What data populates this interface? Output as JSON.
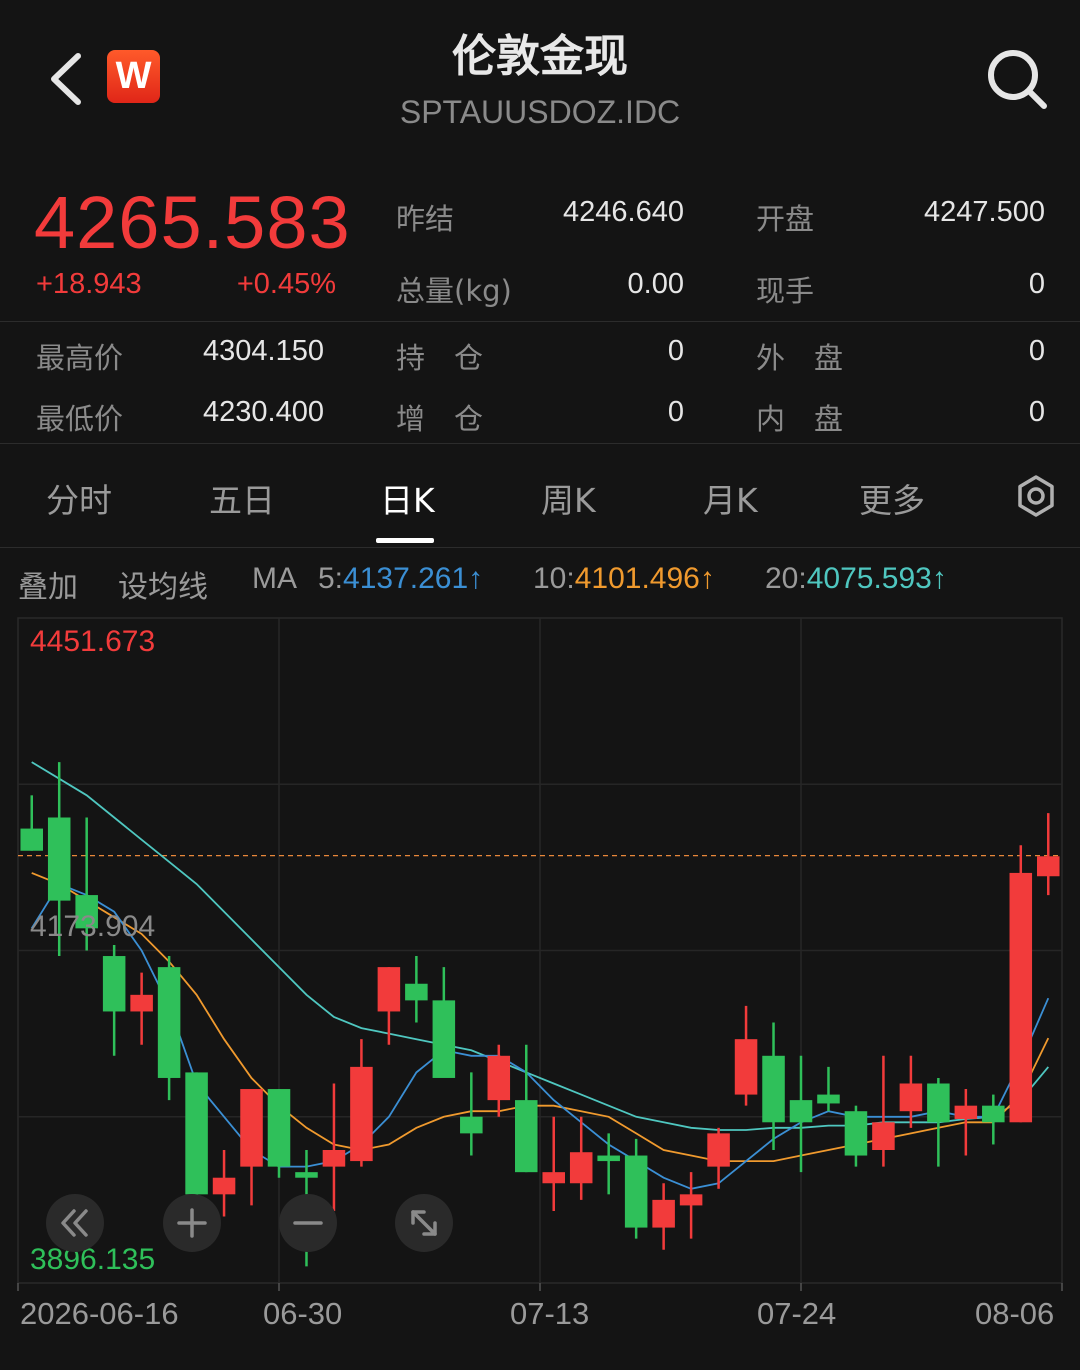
{
  "header": {
    "title": "伦敦金现",
    "code": "SPTAUUSDOZ.IDC",
    "logo_text": "W"
  },
  "quote": {
    "price": "4265.583",
    "change": "+18.943",
    "change_pct": "+0.45%",
    "fields": [
      {
        "label": "昨结",
        "value": "4246.640"
      },
      {
        "label": "开盘",
        "value": "4247.500"
      },
      {
        "label": "总量(kg)",
        "value": "0.00"
      },
      {
        "label": "现手",
        "value": "0"
      },
      {
        "label": "最高价",
        "value": "4304.150"
      },
      {
        "label": "持　仓",
        "value": "0"
      },
      {
        "label": "外　盘",
        "value": "0"
      },
      {
        "label": "最低价",
        "value": "4230.400"
      },
      {
        "label": "增　仓",
        "value": "0"
      },
      {
        "label": "内　盘",
        "value": "0"
      }
    ]
  },
  "tabs": [
    {
      "label": "分时",
      "active": false
    },
    {
      "label": "五日",
      "active": false
    },
    {
      "label": "日K",
      "active": true
    },
    {
      "label": "周K",
      "active": false
    },
    {
      "label": "月K",
      "active": false
    },
    {
      "label": "更多",
      "active": false
    }
  ],
  "ma_bar": {
    "overlay": "叠加",
    "set_ma": "设均线",
    "ma": "MA",
    "ma5_label": "5:",
    "ma5_value": "4137.261↑",
    "ma10_label": "10:",
    "ma10_value": "4101.496↑",
    "ma20_label": "20:",
    "ma20_value": "4075.593↑"
  },
  "colors": {
    "up": "#f23b3b",
    "down": "#2fc05a",
    "ma5": "#3b8fd4",
    "ma10": "#f09a2e",
    "ma20": "#4fc7c0",
    "background": "#141414"
  },
  "icons": {
    "back": "back-arrow-icon",
    "search": "search-icon",
    "settings": "gear-icon",
    "rewind": "double-chevron-left-icon",
    "zoom_in": "plus-icon",
    "zoom_out": "minus-icon",
    "fullscreen": "expand-icon"
  },
  "chart_data": {
    "type": "candlestick",
    "x_labels": [
      "2026-06-16",
      "06-30",
      "07-13",
      "07-24",
      "08-06"
    ],
    "max_label": "4451.673",
    "min_label": "3896.135",
    "mid_label": "4173.904",
    "ylim": [
      3880,
      4480
    ],
    "last_price": 4265.583,
    "candles": [
      {
        "o": 4290,
        "h": 4320,
        "l": 4270,
        "c": 4270
      },
      {
        "o": 4300,
        "h": 4350,
        "l": 4175,
        "c": 4225
      },
      {
        "o": 4230,
        "h": 4300,
        "l": 4180,
        "c": 4200
      },
      {
        "o": 4175,
        "h": 4185,
        "l": 4085,
        "c": 4125
      },
      {
        "o": 4125,
        "h": 4160,
        "l": 4095,
        "c": 4140
      },
      {
        "o": 4165,
        "h": 4175,
        "l": 4045,
        "c": 4065
      },
      {
        "o": 4070,
        "h": 4070,
        "l": 3925,
        "c": 3960
      },
      {
        "o": 3960,
        "h": 4000,
        "l": 3940,
        "c": 3975
      },
      {
        "o": 3985,
        "h": 4040,
        "l": 3950,
        "c": 4055
      },
      {
        "o": 4055,
        "h": 4055,
        "l": 3975,
        "c": 3985
      },
      {
        "o": 3980,
        "h": 4000,
        "l": 3895,
        "c": 3975
      },
      {
        "o": 3985,
        "h": 4060,
        "l": 3945,
        "c": 4000
      },
      {
        "o": 3990,
        "h": 4100,
        "l": 3985,
        "c": 4075
      },
      {
        "o": 4125,
        "h": 4165,
        "l": 4095,
        "c": 4165
      },
      {
        "o": 4150,
        "h": 4175,
        "l": 4115,
        "c": 4135
      },
      {
        "o": 4135,
        "h": 4165,
        "l": 4085,
        "c": 4065
      },
      {
        "o": 4030,
        "h": 4070,
        "l": 3995,
        "c": 4015
      },
      {
        "o": 4045,
        "h": 4095,
        "l": 4030,
        "c": 4085
      },
      {
        "o": 4045,
        "h": 4095,
        "l": 3980,
        "c": 3980
      },
      {
        "o": 3970,
        "h": 4030,
        "l": 3945,
        "c": 3980
      },
      {
        "o": 3970,
        "h": 4030,
        "l": 3955,
        "c": 3998
      },
      {
        "o": 3995,
        "h": 4015,
        "l": 3960,
        "c": 3990
      },
      {
        "o": 3995,
        "h": 4010,
        "l": 3920,
        "c": 3930
      },
      {
        "o": 3930,
        "h": 3970,
        "l": 3910,
        "c": 3955
      },
      {
        "o": 3950,
        "h": 3980,
        "l": 3920,
        "c": 3960
      },
      {
        "o": 3985,
        "h": 4020,
        "l": 3965,
        "c": 4015
      },
      {
        "o": 4050,
        "h": 4130,
        "l": 4040,
        "c": 4100
      },
      {
        "o": 4085,
        "h": 4115,
        "l": 4000,
        "c": 4025
      },
      {
        "o": 4045,
        "h": 4085,
        "l": 3980,
        "c": 4025
      },
      {
        "o": 4050,
        "h": 4075,
        "l": 4035,
        "c": 4042
      },
      {
        "o": 4035,
        "h": 4040,
        "l": 3985,
        "c": 3995
      },
      {
        "o": 4000,
        "h": 4085,
        "l": 3985,
        "c": 4025
      },
      {
        "o": 4035,
        "h": 4085,
        "l": 4020,
        "c": 4060
      },
      {
        "o": 4060,
        "h": 4065,
        "l": 3985,
        "c": 4025
      },
      {
        "o": 4028,
        "h": 4055,
        "l": 3995,
        "c": 4040
      },
      {
        "o": 4040,
        "h": 4050,
        "l": 4005,
        "c": 4025
      },
      {
        "o": 4025,
        "h": 4275,
        "l": 4025,
        "c": 4250
      },
      {
        "o": 4247,
        "h": 4304,
        "l": 4230,
        "c": 4265
      }
    ],
    "ma5": [
      4200,
      4240,
      4230,
      4215,
      4180,
      4130,
      4060,
      4030,
      4000,
      3985,
      3985,
      3990,
      4005,
      4030,
      4070,
      4090,
      4085,
      4085,
      4070,
      4045,
      4025,
      4005,
      3990,
      3975,
      3965,
      3970,
      3990,
      4010,
      4025,
      4035,
      4030,
      4030,
      4030,
      4035,
      4030,
      4030,
      4080,
      4137
    ],
    "ma10": [
      4250,
      4240,
      4225,
      4210,
      4195,
      4170,
      4140,
      4100,
      4065,
      4040,
      4020,
      4005,
      4000,
      4005,
      4020,
      4030,
      4035,
      4035,
      4040,
      4040,
      4035,
      4030,
      4015,
      4000,
      3995,
      3990,
      3990,
      3990,
      3995,
      4000,
      4005,
      4010,
      4015,
      4020,
      4025,
      4025,
      4050,
      4101
    ],
    "ma20": [
      4350,
      4335,
      4320,
      4300,
      4280,
      4260,
      4240,
      4215,
      4190,
      4165,
      4140,
      4120,
      4110,
      4105,
      4100,
      4095,
      4090,
      4080,
      4070,
      4060,
      4050,
      4040,
      4030,
      4025,
      4020,
      4018,
      4018,
      4020,
      4020,
      4022,
      4022,
      4025,
      4025,
      4025,
      4028,
      4030,
      4045,
      4075
    ]
  }
}
